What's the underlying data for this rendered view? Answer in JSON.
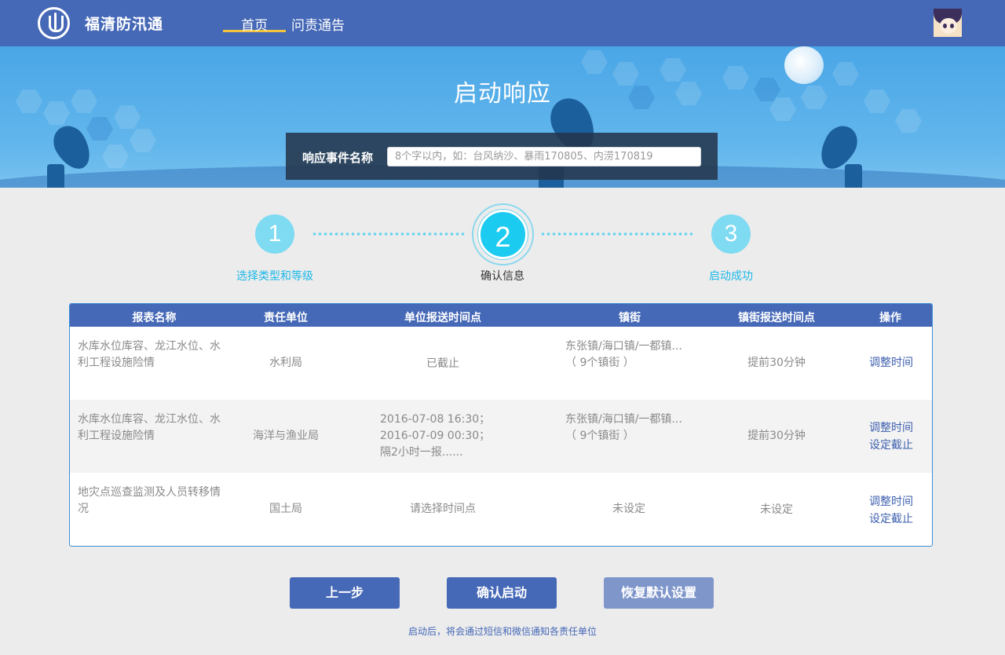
{
  "header": {
    "brand": "福清防汛通",
    "nav": {
      "home": "首页",
      "notice": "问责通告"
    }
  },
  "banner": {
    "title": "启动响应",
    "event_label": "响应事件名称",
    "event_placeholder": "8个字以内，如：台风纳沙、暴雨170805、内涝170819",
    "event_value": ""
  },
  "steps": [
    {
      "number": "1",
      "label": "选择类型和等级",
      "state": "done"
    },
    {
      "number": "2",
      "label": "确认信息",
      "state": "current"
    },
    {
      "number": "3",
      "label": "启动成功",
      "state": "pending"
    }
  ],
  "table": {
    "columns": [
      "报表名称",
      "责任单位",
      "单位报送时间点",
      "镇街",
      "镇街报送时间点",
      "操作"
    ],
    "rows": [
      {
        "name_line1": "水库水位库容、龙江水位、水",
        "name_line2": "利工程设施险情",
        "unit": "水利局",
        "time_line1": "已截止",
        "time_line2": "",
        "time_line3": "",
        "town_line1": "东张镇/海口镇/一都镇...",
        "town_line2": "（ 9个镇街 ）",
        "town_time": "提前30分钟",
        "op1": "调整时间",
        "op2": ""
      },
      {
        "name_line1": "水库水位库容、龙江水位、水",
        "name_line2": "利工程设施险情",
        "unit": "海洋与渔业局",
        "time_line1": "2016-07-08   16:30；",
        "time_line2": "2016-07-09   00:30；",
        "time_line3": "隔2小时一报......",
        "town_line1": "东张镇/海口镇/一都镇...",
        "town_line2": "（ 9个镇街 ）",
        "town_time": "提前30分钟",
        "op1": "调整时间",
        "op2": "设定截止"
      },
      {
        "name_line1": "地灾点巡查监测及人员转移情",
        "name_line2": "况",
        "unit": "国土局",
        "time_line1": "请选择时间点",
        "time_line2": "",
        "time_line3": "",
        "town_line1": "未设定",
        "town_line2": "",
        "town_time": "未设定",
        "op1": "调整时间",
        "op2": "设定截止"
      }
    ]
  },
  "buttons": {
    "prev": "上一步",
    "confirm": "确认启动",
    "reset": "恢复默认设置"
  },
  "footer_note": "启动后，将会通过短信和微信通知各责任单位",
  "colors": {
    "primary": "#4568b7",
    "accent": "#1ccbf0",
    "step_inactive": "#7fdbf2",
    "link": "#3d5fae"
  }
}
